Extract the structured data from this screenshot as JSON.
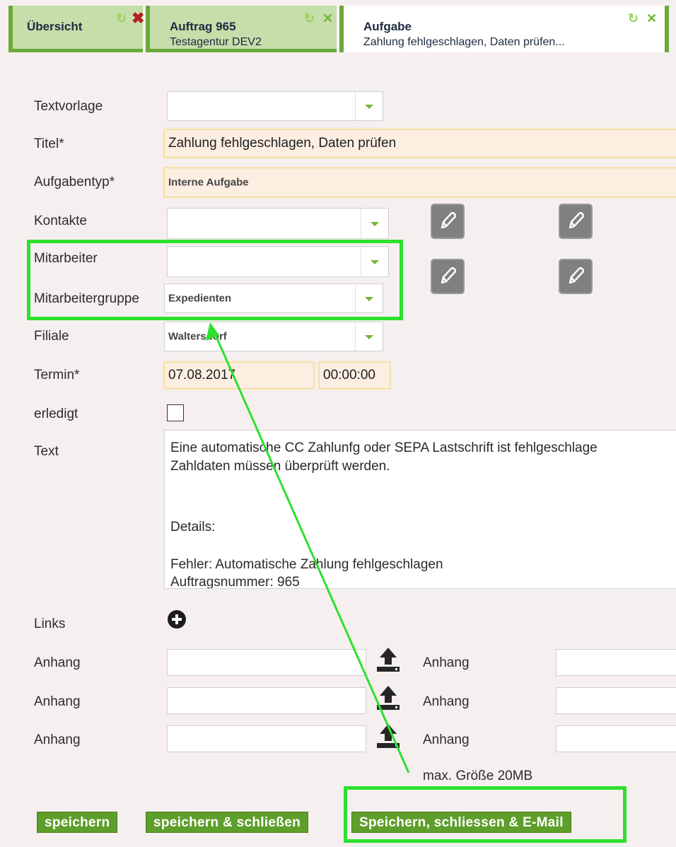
{
  "tabs": [
    {
      "title": "Übersicht",
      "subtitle": ""
    },
    {
      "title": "Auftrag 965",
      "subtitle": "Testagentur DEV2"
    },
    {
      "title": "Aufgabe",
      "subtitle": "Zahlung fehlgeschlagen, Daten prüfen..."
    }
  ],
  "form": {
    "textvorlage": {
      "label": "Textvorlage",
      "value": ""
    },
    "titel": {
      "label": "Titel*",
      "value": "Zahlung fehlgeschlagen, Daten prüfen"
    },
    "aufgabentyp": {
      "label": "Aufgabentyp*",
      "value": "Interne Aufgabe"
    },
    "kontakte": {
      "label": "Kontakte",
      "value": ""
    },
    "mitarbeiter": {
      "label": "Mitarbeiter",
      "value": ""
    },
    "mitarbeitergruppe": {
      "label": "Mitarbeitergruppe",
      "value": "Expedienten"
    },
    "filiale": {
      "label": "Filiale",
      "value": "Waltersdorf"
    },
    "termin": {
      "label": "Termin*",
      "date": "07.08.2017",
      "time": "00:00:00"
    },
    "erledigt": {
      "label": "erledigt",
      "checked": false
    },
    "text": {
      "label": "Text",
      "lines": [
        "Eine automatische CC Zahlunfg oder SEPA Lastschrift ist fehlgeschlage",
        "Zahldaten müssen überprüft werden.",
        "",
        "",
        "Details:",
        "",
        "Fehler: Automatische Zahlung fehlgeschlagen",
        "Auftragsnummer: 965"
      ]
    },
    "links": {
      "label": "Links"
    },
    "anhang_label": "Anhang",
    "max_size": "max. Größe 20MB"
  },
  "buttons": {
    "save": "speichern",
    "save_close": "speichern & schließen",
    "save_close_email": "Speichern, schliessen & E-Mail"
  },
  "colors": {
    "accent_green": "#6aa938",
    "highlight_green": "#2ee02e",
    "button_green": "#5e9e2b"
  },
  "icons": [
    "refresh-icon",
    "close-icon",
    "edit-icon",
    "plus-circle-icon",
    "upload-icon",
    "chevron-down-icon"
  ]
}
